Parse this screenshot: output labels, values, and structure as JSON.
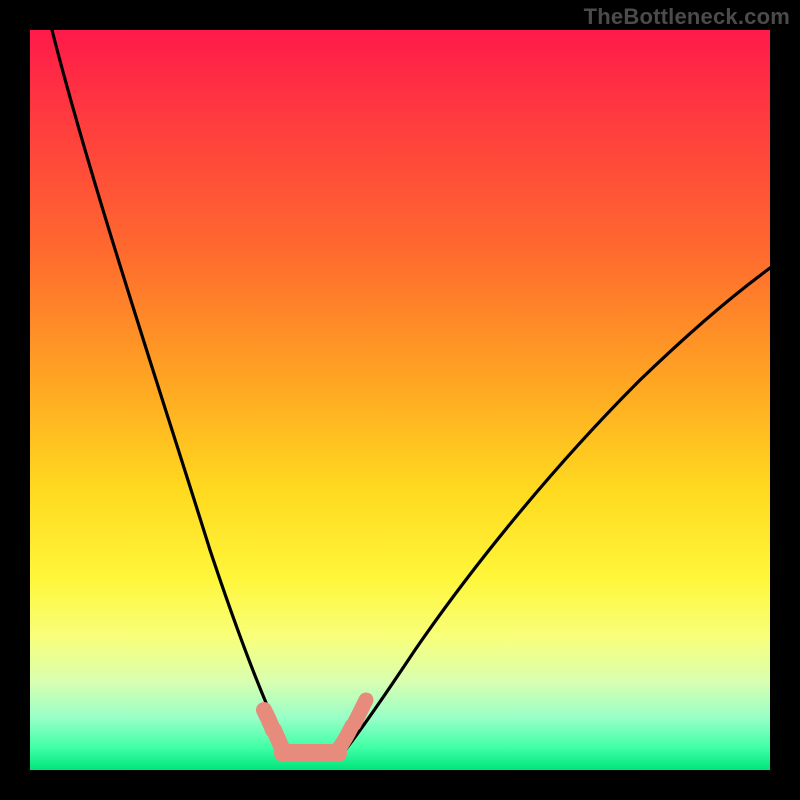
{
  "watermark": "TheBottleneck.com",
  "chart_data": {
    "type": "line",
    "title": "",
    "xlabel": "",
    "ylabel": "",
    "xlim": [
      0,
      100
    ],
    "ylim": [
      0,
      100
    ],
    "grid": false,
    "legend": false,
    "series": [
      {
        "name": "left-curve-black",
        "color": "#000000",
        "x": [
          3,
          8,
          14,
          20,
          25,
          29,
          32,
          33.5,
          34.5,
          35.5
        ],
        "y": [
          100,
          80,
          60,
          40,
          24,
          13,
          6.5,
          4.5,
          4,
          4
        ]
      },
      {
        "name": "right-curve-black",
        "color": "#000000",
        "x": [
          42,
          44,
          48,
          55,
          64,
          76,
          88,
          100
        ],
        "y": [
          4,
          5,
          8.5,
          16,
          28,
          44,
          57,
          68
        ]
      },
      {
        "name": "valley-bottom-salmon",
        "color": "#e78b7d",
        "x": [
          32,
          33,
          34,
          35,
          36.5,
          38,
          39.5,
          41,
          42.5,
          43.5,
          45
        ],
        "y": [
          7.5,
          5,
          3.5,
          2.5,
          2.2,
          2.2,
          2.2,
          2.5,
          3.5,
          5.5,
          8.5
        ]
      }
    ],
    "annotations": []
  },
  "colors": {
    "gradient_top": "#ff1a4a",
    "gradient_mid": "#ffd91f",
    "gradient_bottom": "#00e57a",
    "curve_black": "#000000",
    "valley_salmon": "#e78b7d",
    "frame": "#000000",
    "watermark": "#4b4b4b"
  }
}
